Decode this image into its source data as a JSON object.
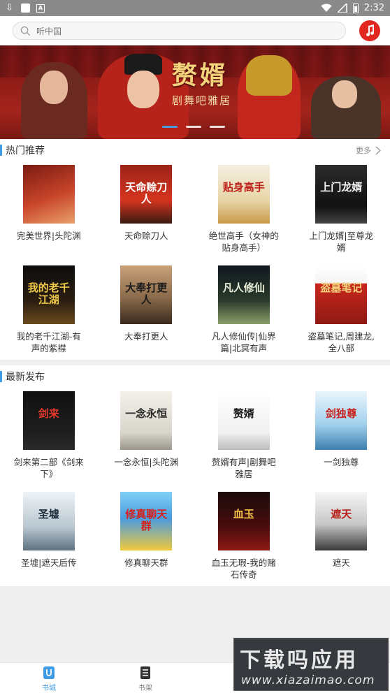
{
  "status_bar": {
    "time": "2:32",
    "notification_icons": [
      "download-icon",
      "app-square-icon",
      "a-icon"
    ],
    "right_icons": [
      "wifi-icon",
      "signal-icon",
      "battery-icon"
    ]
  },
  "search": {
    "placeholder": "听中国"
  },
  "colors": {
    "accent": "#3e9be5",
    "music_button": "#e0261e",
    "status_bar": "#8a8a8a"
  },
  "banner": {
    "title": "赘婿",
    "subtitle": "剧舞吧雅居",
    "dots": 3,
    "active_dot": 1
  },
  "hot": {
    "title": "热门推荐",
    "more": "更多",
    "books": [
      {
        "title": "完美世界|头陀渊"
      },
      {
        "title": "天命赊刀人",
        "cover_text": "天命赊刀人"
      },
      {
        "title": "绝世高手（女神的贴身高手）",
        "cover_text": "贴身高手"
      },
      {
        "title": "上门龙婿|至尊龙婿",
        "cover_text": "上门龙婿"
      },
      {
        "title": "我的老千江湖-有声的紫襟",
        "cover_text": "我的老千江湖"
      },
      {
        "title": "大奉打更人",
        "cover_text": "大奉打更人"
      },
      {
        "title": "凡人修仙传|仙界篇|北冥有声",
        "cover_text": "凡人修仙"
      },
      {
        "title": "盗墓笔记,周建龙,全八部",
        "cover_text": "盗墓笔记"
      }
    ]
  },
  "latest": {
    "title": "最新发布",
    "books": [
      {
        "title": "剑来第二部《剑来下》",
        "cover_text": "剑来"
      },
      {
        "title": "一念永恒|头陀渊",
        "cover_text": "一念永恒"
      },
      {
        "title": "赘婿有声|剧舞吧雅居",
        "cover_text": "赘婿"
      },
      {
        "title": "一剑独尊",
        "cover_text": "剑独尊"
      },
      {
        "title": "圣墟|遮天后传",
        "cover_text": "圣墟"
      },
      {
        "title": "修真聊天群",
        "cover_text": "修真聊天群"
      },
      {
        "title": "血玉无瑕-我的赌石传奇",
        "cover_text": "血玉"
      },
      {
        "title": "遮天",
        "cover_text": "遮天"
      }
    ]
  },
  "tabs": [
    {
      "label": "书城",
      "icon": "store-icon",
      "active": true
    },
    {
      "label": "书架",
      "icon": "shelf-icon",
      "active": false
    }
  ],
  "watermark": {
    "line1": "下载吗应用",
    "line2": "www.xiazaimao.com"
  }
}
